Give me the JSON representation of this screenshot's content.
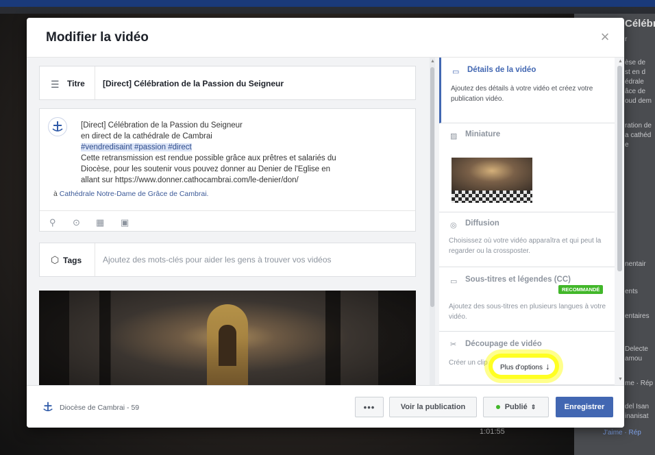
{
  "background": {
    "side_title": "Célébr",
    "side_lines": [
      "r",
      "èse de",
      "st en d",
      "édrale",
      "âce de",
      "oud dem",
      "ration de",
      "a cathéd",
      "e",
      "nentair",
      "ents",
      "entaires",
      "Delecte",
      "amou",
      "me · Rép",
      "del Isan",
      "inanisat",
      "J'aime · Rép"
    ],
    "video_time": "1:01:55"
  },
  "modal": {
    "title": "Modifier la vidéo",
    "close_label": "×"
  },
  "title_field": {
    "label": "Titre",
    "value": "[Direct] Célébration de la Passion du Seigneur"
  },
  "description": {
    "line1": "[Direct] Célébration de la Passion du Seigneur",
    "line2": "en direct de la cathédrale de Cambrai",
    "hashtags": "#vendredisaint #passion #direct",
    "line4": "Cette retransmission est rendue possible grâce aux prêtres et salariés du",
    "line5": "Diocèse, pour les soutenir vous pouvez donner au Denier de l'Eglise en",
    "line6": "allant sur https://www.donner.cathocambrai.com/le-denier/don/",
    "location_prefix": "à",
    "location": "Cathédrale Notre-Dame de Grâce de Cambrai."
  },
  "tags": {
    "label": "Tags",
    "placeholder": "Ajoutez des mots-clés pour aider les gens à trouver vos vidéos"
  },
  "steps": [
    {
      "title": "Détails de la vidéo",
      "desc": "Ajoutez des détails à votre vidéo et créez votre publication vidéo."
    },
    {
      "title": "Miniature"
    },
    {
      "title": "Diffusion",
      "desc": "Choisissez où votre vidéo apparaîtra et qui peut la regarder ou la crossposter."
    },
    {
      "title": "Sous-titres et légendes (CC)",
      "badge": "RECOMMANDÉ",
      "desc": "Ajoutez des sous-titres en plusieurs langues à votre vidéo."
    },
    {
      "title": "Découpage de vidéo",
      "desc": "Créer un clip"
    }
  ],
  "more_options": "Plus d'options",
  "footer": {
    "page_name": "Diocèse de Cambrai - 59",
    "more": "•••",
    "view_post": "Voir la publication",
    "status": "Publié",
    "save": "Enregistrer"
  },
  "colors": {
    "accent": "#4267b2",
    "success": "#42b72a",
    "highlight": "#ffff00"
  }
}
